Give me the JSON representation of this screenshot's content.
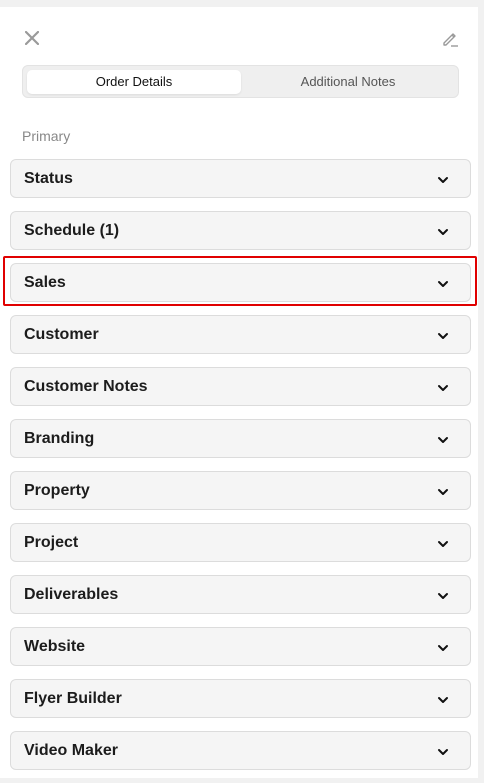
{
  "header": {
    "close_icon": "close-icon",
    "edit_icon": "edit-pencil-icon"
  },
  "tabs": [
    {
      "label": "Order Details",
      "active": true
    },
    {
      "label": "Additional Notes",
      "active": false
    }
  ],
  "section": {
    "label": "Primary"
  },
  "accordion_items": [
    {
      "label": "Status"
    },
    {
      "label": "Schedule (1)"
    },
    {
      "label": "Sales",
      "highlighted": true
    },
    {
      "label": "Customer"
    },
    {
      "label": "Customer Notes"
    },
    {
      "label": "Branding"
    },
    {
      "label": "Property"
    },
    {
      "label": "Project"
    },
    {
      "label": "Deliverables"
    },
    {
      "label": "Website"
    },
    {
      "label": "Flyer Builder"
    },
    {
      "label": "Video Maker"
    }
  ],
  "colors": {
    "highlight_border": "#e00000",
    "item_background": "#f5f5f5",
    "active_tab_background": "#ffffff"
  }
}
